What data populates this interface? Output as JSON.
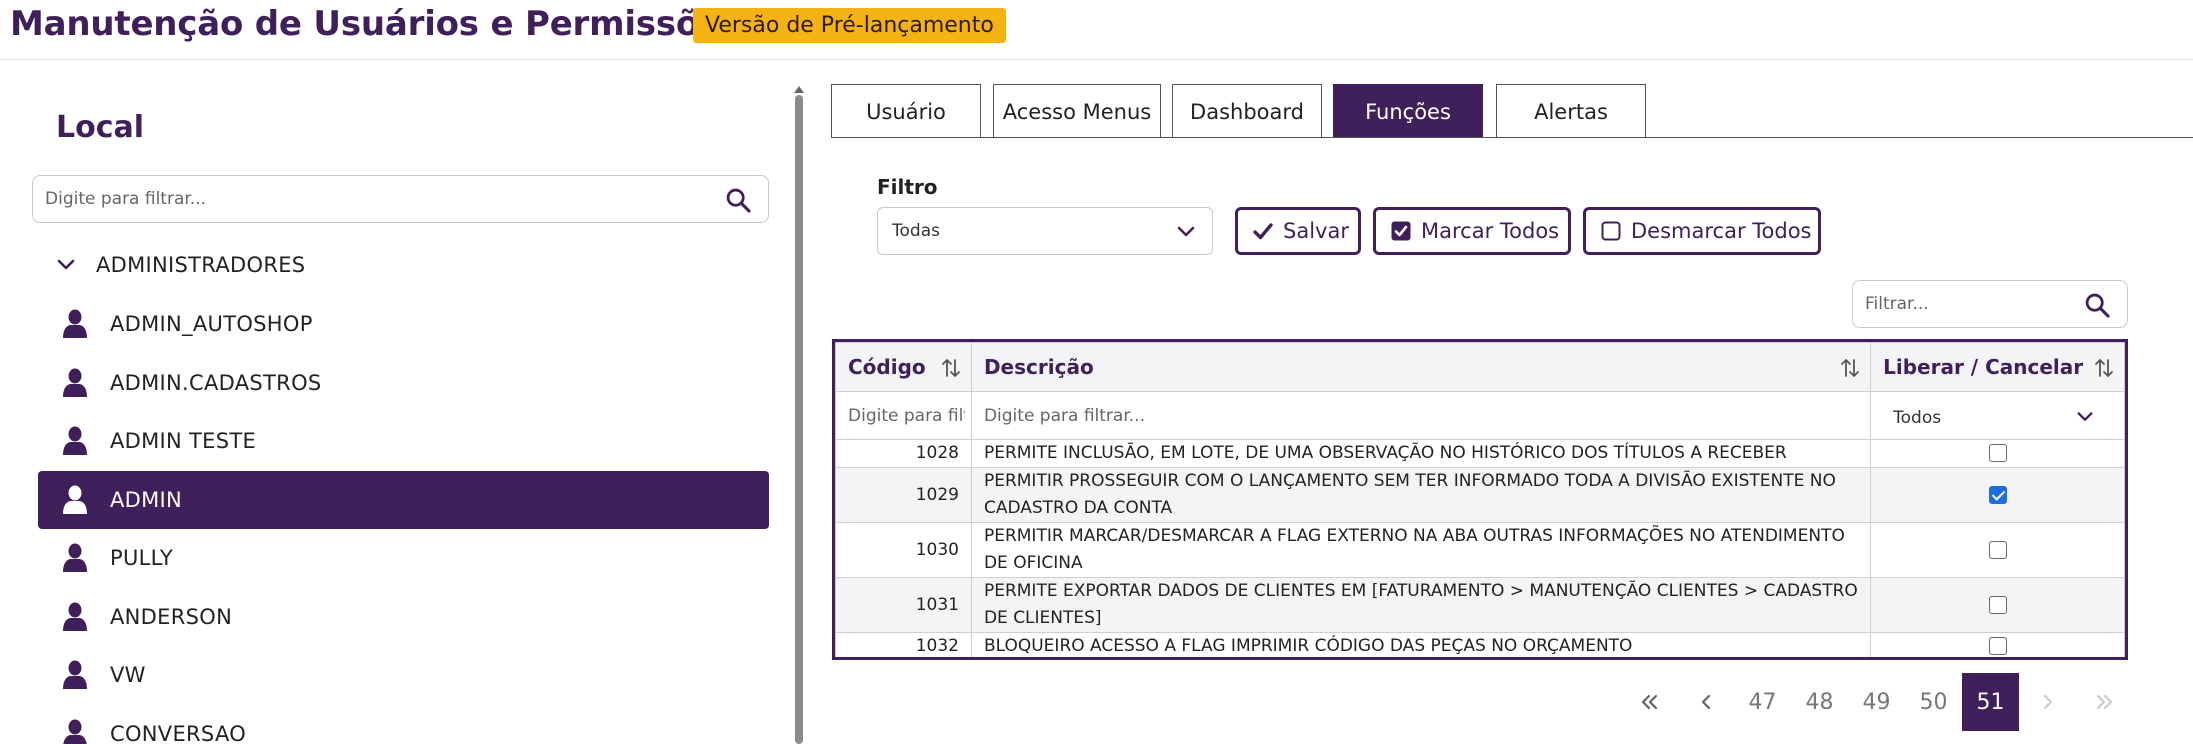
{
  "header": {
    "title": "Manutenção de Usuários e Permissões",
    "badge": "Versão de Pré-lançamento"
  },
  "sidebar": {
    "title": "Local",
    "search_placeholder": "Digite para filtrar...",
    "group": "ADMINISTRADORES",
    "items": [
      {
        "label": "ADMIN_AUTOSHOP",
        "selected": false
      },
      {
        "label": "ADMIN.CADASTROS",
        "selected": false
      },
      {
        "label": "ADMIN TESTE",
        "selected": false
      },
      {
        "label": "ADMIN",
        "selected": true
      },
      {
        "label": "PULLY",
        "selected": false
      },
      {
        "label": "ANDERSON",
        "selected": false
      },
      {
        "label": "VW",
        "selected": false
      },
      {
        "label": "CONVERSAO",
        "selected": false
      }
    ]
  },
  "tabs": [
    {
      "label": "Usuário",
      "active": false
    },
    {
      "label": "Acesso Menus",
      "active": false
    },
    {
      "label": "Dashboard",
      "active": false
    },
    {
      "label": "Funções",
      "active": true
    },
    {
      "label": "Alertas",
      "active": false
    }
  ],
  "toolbar": {
    "filter_label": "Filtro",
    "filter_value": "Todas",
    "save_label": "Salvar",
    "check_all_label": "Marcar Todos",
    "uncheck_all_label": "Desmarcar Todos",
    "table_search_placeholder": "Filtrar..."
  },
  "table": {
    "columns": [
      "Código",
      "Descrição",
      "Liberar / Cancelar"
    ],
    "filters": {
      "code_placeholder": "Digite para filtrar...",
      "desc_placeholder": "Digite para filtrar...",
      "status_value": "Todos"
    },
    "rows": [
      {
        "code": "1028",
        "desc": "PERMITE INCLUSÃO, EM LOTE, DE UMA OBSERVAÇÃO NO HISTÓRICO DOS TÍTULOS A RECEBER",
        "checked": false
      },
      {
        "code": "1029",
        "desc": "PERMITIR PROSSEGUIR COM O LANÇAMENTO SEM TER INFORMADO TODA A DIVISÃO EXISTENTE NO CADASTRO DA CONTA",
        "checked": true
      },
      {
        "code": "1030",
        "desc": "PERMITIR MARCAR/DESMARCAR A FLAG EXTERNO NA ABA OUTRAS INFORMAÇÕES NO ATENDIMENTO DE OFICINA",
        "checked": false
      },
      {
        "code": "1031",
        "desc": "PERMITE EXPORTAR DADOS DE CLIENTES EM [FATURAMENTO > MANUTENÇÃO CLIENTES > CADASTRO DE CLIENTES]",
        "checked": false
      },
      {
        "code": "1032",
        "desc": "BLOQUEIRO ACESSO A FLAG IMPRIMIR CÓDIGO DAS PEÇAS NO ORÇAMENTO",
        "checked": false
      }
    ]
  },
  "pagination": {
    "pages": [
      "47",
      "48",
      "49",
      "50",
      "51"
    ],
    "current": "51"
  },
  "colors": {
    "primary": "#40205a",
    "badge": "#f5b313",
    "checkbox": "#1d6fe0"
  }
}
